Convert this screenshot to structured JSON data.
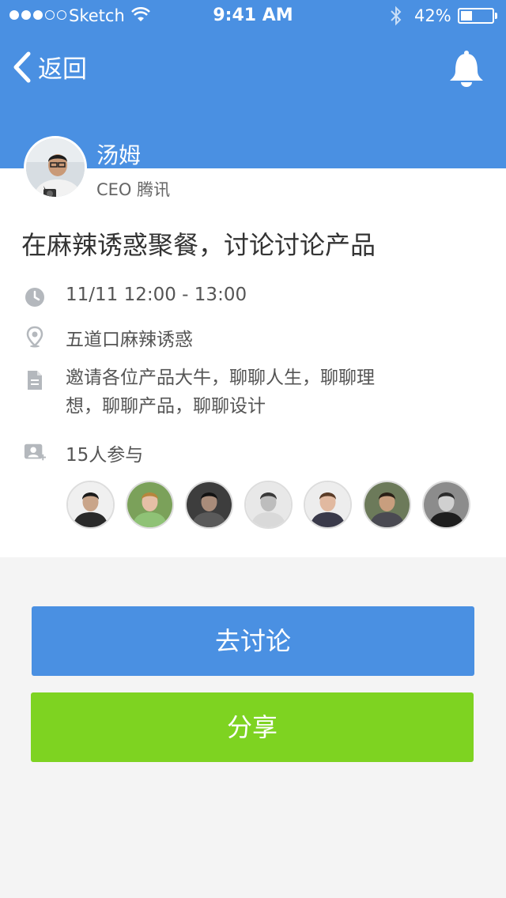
{
  "status": {
    "carrier": "Sketch",
    "time": "9:41 AM",
    "battery": "42%"
  },
  "nav": {
    "back_label": "返回"
  },
  "host": {
    "name": "汤姆",
    "title": "CEO 腾讯"
  },
  "event": {
    "title": "在麻辣诱惑聚餐，讨论讨论产品",
    "time": "11/11  12:00 - 13:00",
    "location": "五道口麻辣诱惑",
    "description": "邀请各位产品大牛，聊聊人生，聊聊理想，聊聊产品，聊聊设计",
    "participants_label": "15人参与"
  },
  "participants": [
    {
      "bg": "#f0f0f0",
      "skin": "#c9a58a",
      "hair": "#1b1b1b",
      "shirt": "#2a2a2a"
    },
    {
      "bg": "#7ba15a",
      "skin": "#e5bfa6",
      "hair": "#b7863c",
      "shirt": "#8fc276"
    },
    {
      "bg": "#3d3d3d",
      "skin": "#a98c7a",
      "hair": "#121212",
      "shirt": "#5a5a5a"
    },
    {
      "bg": "#e8e8e8",
      "skin": "#bdbdbd",
      "hair": "#3a3a3a",
      "shirt": "#d9d9d9"
    },
    {
      "bg": "#ededed",
      "skin": "#e1b9a0",
      "hair": "#5a3c28",
      "shirt": "#3a3a4a"
    },
    {
      "bg": "#6c7a5a",
      "skin": "#c89e7e",
      "hair": "#2a2016",
      "shirt": "#4a4a52"
    },
    {
      "bg": "#8c8c8c",
      "skin": "#d0d0d0",
      "hair": "#2b2b2b",
      "shirt": "#1e1e1e"
    }
  ],
  "actions": {
    "discuss_label": "去讨论",
    "share_label": "分享"
  },
  "colors": {
    "primary": "#4a90e2",
    "share": "#7ed321",
    "icon": "#b4b8bd"
  }
}
